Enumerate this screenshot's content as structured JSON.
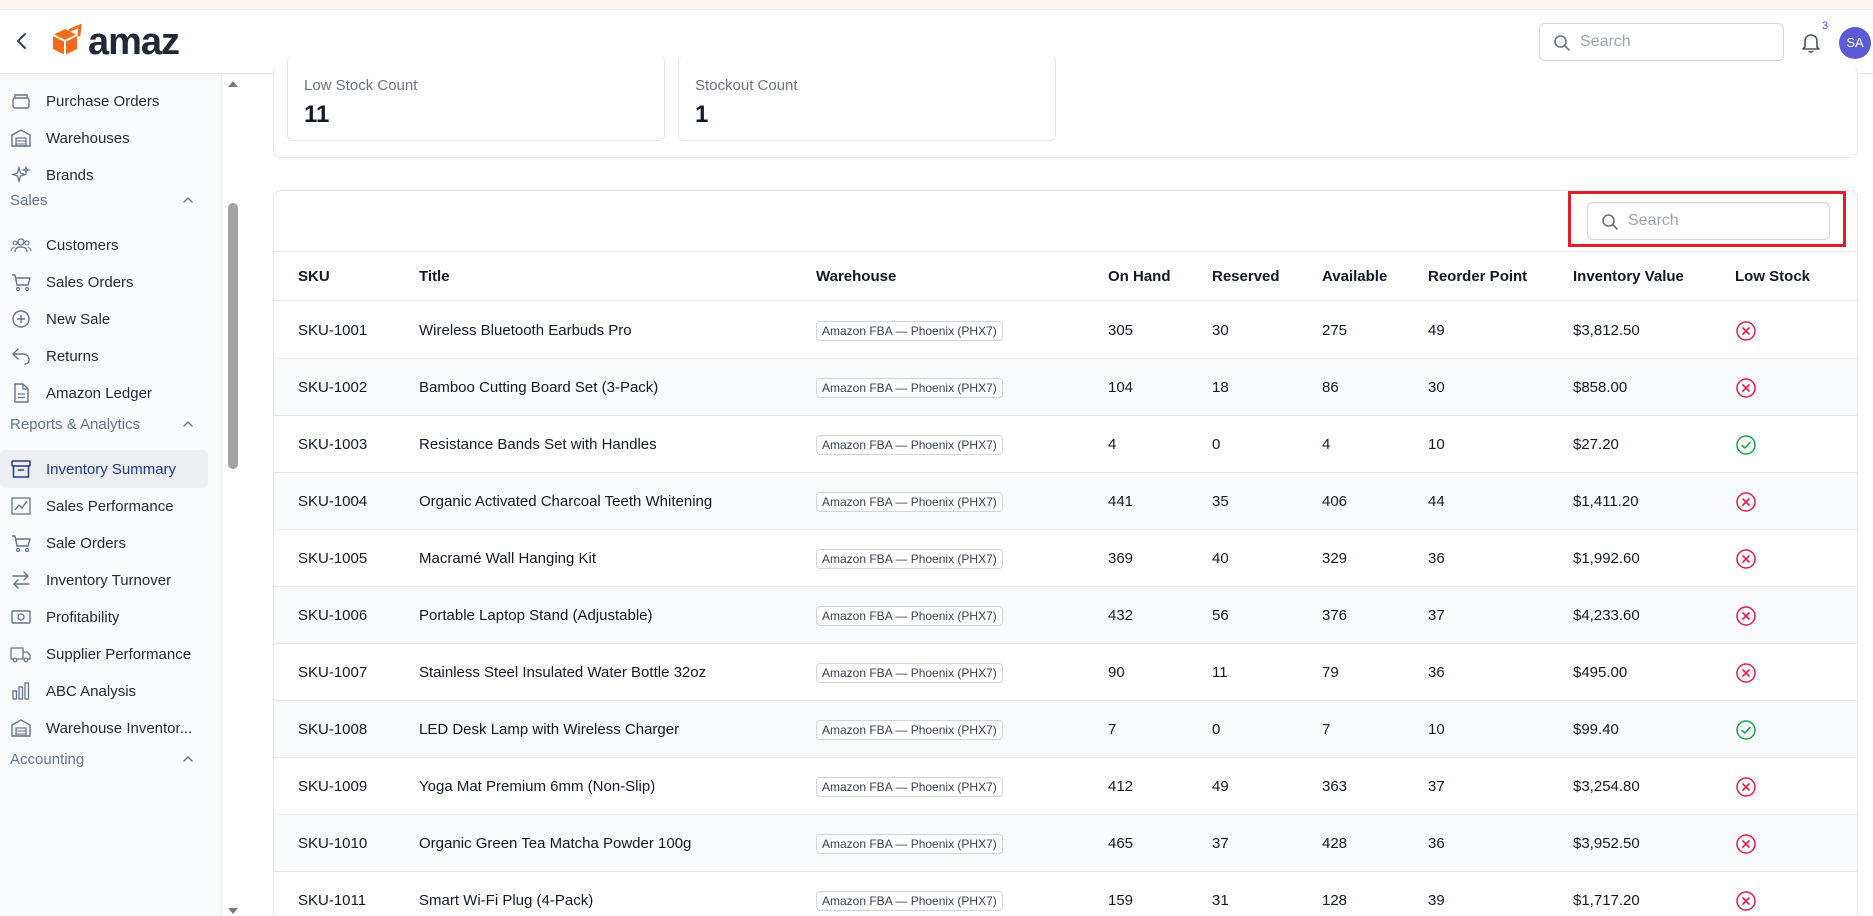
{
  "header": {
    "logo_text": "amaz",
    "search_placeholder": "Search",
    "notification_count": "3",
    "avatar_initials": "SA"
  },
  "sidebar": {
    "items_top": [
      {
        "label": "Purchase Orders",
        "icon": "box-icon"
      },
      {
        "label": "Warehouses",
        "icon": "warehouse-icon"
      },
      {
        "label": "Brands",
        "icon": "sparkles-icon"
      }
    ],
    "sales_title": "Sales",
    "sales_items": [
      {
        "label": "Customers",
        "icon": "users-icon"
      },
      {
        "label": "Sales Orders",
        "icon": "cart-icon"
      },
      {
        "label": "New Sale",
        "icon": "plus-circle-icon"
      },
      {
        "label": "Returns",
        "icon": "return-icon"
      },
      {
        "label": "Amazon Ledger",
        "icon": "document-icon"
      }
    ],
    "reports_title": "Reports & Analytics",
    "reports_items": [
      {
        "label": "Inventory Summary",
        "icon": "archive-icon",
        "active": true
      },
      {
        "label": "Sales Performance",
        "icon": "chart-line-icon"
      },
      {
        "label": "Sale Orders",
        "icon": "cart-icon"
      },
      {
        "label": "Inventory Turnover",
        "icon": "arrows-exchange-icon"
      },
      {
        "label": "Profitability",
        "icon": "cash-icon"
      },
      {
        "label": "Supplier Performance",
        "icon": "truck-icon"
      },
      {
        "label": "ABC Analysis",
        "icon": "bar-chart-icon"
      },
      {
        "label": "Warehouse Inventor...",
        "icon": "warehouse-icon"
      }
    ],
    "accounting_title": "Accounting"
  },
  "stats": [
    {
      "label": "Low Stock Count",
      "value": "11"
    },
    {
      "label": "Stockout Count",
      "value": "1"
    }
  ],
  "table": {
    "search_placeholder": "Search",
    "columns": [
      "SKU",
      "Title",
      "Warehouse",
      "On Hand",
      "Reserved",
      "Available",
      "Reorder Point",
      "Inventory Value",
      "Low Stock"
    ],
    "rows": [
      {
        "sku": "SKU-1001",
        "title": "Wireless Bluetooth Earbuds Pro",
        "warehouse": "Amazon FBA — Phoenix (PHX7)",
        "on_hand": "305",
        "reserved": "30",
        "available": "275",
        "reorder": "49",
        "value": "$3,812.50",
        "low": false
      },
      {
        "sku": "SKU-1002",
        "title": "Bamboo Cutting Board Set (3-Pack)",
        "warehouse": "Amazon FBA — Phoenix (PHX7)",
        "on_hand": "104",
        "reserved": "18",
        "available": "86",
        "reorder": "30",
        "value": "$858.00",
        "low": false
      },
      {
        "sku": "SKU-1003",
        "title": "Resistance Bands Set with Handles",
        "warehouse": "Amazon FBA — Phoenix (PHX7)",
        "on_hand": "4",
        "reserved": "0",
        "available": "4",
        "reorder": "10",
        "value": "$27.20",
        "low": true
      },
      {
        "sku": "SKU-1004",
        "title": "Organic Activated Charcoal Teeth Whitening",
        "warehouse": "Amazon FBA — Phoenix (PHX7)",
        "on_hand": "441",
        "reserved": "35",
        "available": "406",
        "reorder": "44",
        "value": "$1,411.20",
        "low": false
      },
      {
        "sku": "SKU-1005",
        "title": "Macramé Wall Hanging Kit",
        "warehouse": "Amazon FBA — Phoenix (PHX7)",
        "on_hand": "369",
        "reserved": "40",
        "available": "329",
        "reorder": "36",
        "value": "$1,992.60",
        "low": false
      },
      {
        "sku": "SKU-1006",
        "title": "Portable Laptop Stand (Adjustable)",
        "warehouse": "Amazon FBA — Phoenix (PHX7)",
        "on_hand": "432",
        "reserved": "56",
        "available": "376",
        "reorder": "37",
        "value": "$4,233.60",
        "low": false
      },
      {
        "sku": "SKU-1007",
        "title": "Stainless Steel Insulated Water Bottle 32oz",
        "warehouse": "Amazon FBA — Phoenix (PHX7)",
        "on_hand": "90",
        "reserved": "11",
        "available": "79",
        "reorder": "36",
        "value": "$495.00",
        "low": false
      },
      {
        "sku": "SKU-1008",
        "title": "LED Desk Lamp with Wireless Charger",
        "warehouse": "Amazon FBA — Phoenix (PHX7)",
        "on_hand": "7",
        "reserved": "0",
        "available": "7",
        "reorder": "10",
        "value": "$99.40",
        "low": true
      },
      {
        "sku": "SKU-1009",
        "title": "Yoga Mat Premium 6mm (Non-Slip)",
        "warehouse": "Amazon FBA — Phoenix (PHX7)",
        "on_hand": "412",
        "reserved": "49",
        "available": "363",
        "reorder": "37",
        "value": "$3,254.80",
        "low": false
      },
      {
        "sku": "SKU-1010",
        "title": "Organic Green Tea Matcha Powder 100g",
        "warehouse": "Amazon FBA — Phoenix (PHX7)",
        "on_hand": "465",
        "reserved": "37",
        "available": "428",
        "reorder": "36",
        "value": "$3,952.50",
        "low": false
      },
      {
        "sku": "SKU-1011",
        "title": "Smart Wi-Fi Plug (4-Pack)",
        "warehouse": "Amazon FBA — Phoenix (PHX7)",
        "on_hand": "159",
        "reserved": "31",
        "available": "128",
        "reorder": "39",
        "value": "$1,717.20",
        "low": false
      }
    ]
  },
  "colors": {
    "accent": "#5b5bd6",
    "low_stock_yes": "#16a34a",
    "low_stock_no": "#e11d48",
    "highlight": "#e11d2a"
  }
}
